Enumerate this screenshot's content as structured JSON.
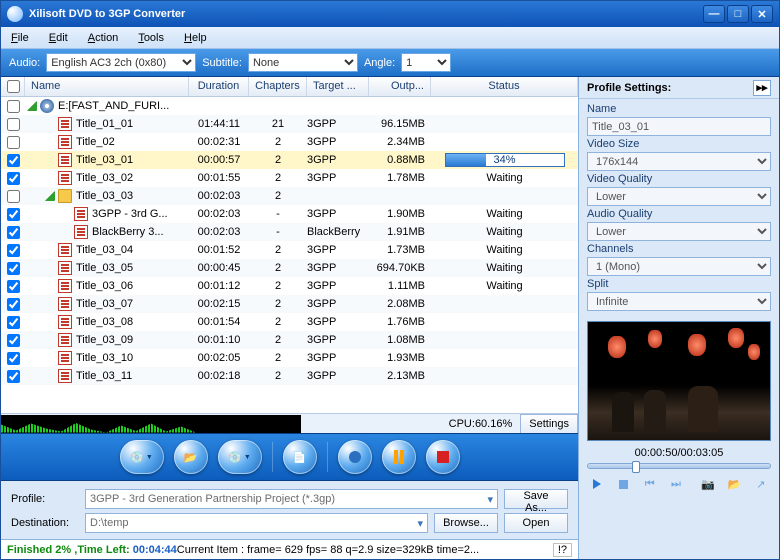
{
  "window": {
    "title": "Xilisoft DVD to 3GP Converter"
  },
  "menu": {
    "file": "File",
    "edit": "Edit",
    "action": "Action",
    "tools": "Tools",
    "help": "Help"
  },
  "params": {
    "audio_label": "Audio:",
    "audio_value": "English AC3 2ch (0x80)",
    "subtitle_label": "Subtitle:",
    "subtitle_value": "None",
    "angle_label": "Angle:",
    "angle_value": "1"
  },
  "columns": {
    "name": "Name",
    "duration": "Duration",
    "chapters": "Chapters",
    "target": "Target ...",
    "outp": "Outp...",
    "status": "Status"
  },
  "rows": [
    {
      "level": 0,
      "chk": false,
      "icon": "disc",
      "tw": true,
      "name": "E:[FAST_AND_FURI...",
      "dur": "",
      "chap": "",
      "target": "",
      "outp": "",
      "status": ""
    },
    {
      "level": 1,
      "chk": false,
      "icon": "doc",
      "name": "Title_01_01",
      "dur": "01:44:11",
      "chap": "21",
      "target": "3GPP",
      "outp": "96.15MB",
      "status": ""
    },
    {
      "level": 1,
      "chk": false,
      "icon": "doc",
      "name": "Title_02",
      "dur": "00:02:31",
      "chap": "2",
      "target": "3GPP",
      "outp": "2.34MB",
      "status": ""
    },
    {
      "level": 1,
      "chk": true,
      "icon": "doc",
      "sel": true,
      "name": "Title_03_01",
      "dur": "00:00:57",
      "chap": "2",
      "target": "3GPP",
      "outp": "0.88MB",
      "status_progress": 34
    },
    {
      "level": 1,
      "chk": true,
      "icon": "doc",
      "name": "Title_03_02",
      "dur": "00:01:55",
      "chap": "2",
      "target": "3GPP",
      "outp": "1.78MB",
      "status": "Waiting"
    },
    {
      "level": 1,
      "chk": false,
      "icon": "folder",
      "tw": true,
      "name": "Title_03_03",
      "dur": "00:02:03",
      "chap": "2",
      "target": "",
      "outp": "",
      "status": ""
    },
    {
      "level": 2,
      "chk": true,
      "icon": "doc",
      "name": "3GPP - 3rd G...",
      "dur": "00:02:03",
      "chap": "-",
      "target": "3GPP",
      "outp": "1.90MB",
      "status": "Waiting"
    },
    {
      "level": 2,
      "chk": true,
      "icon": "doc",
      "name": "BlackBerry 3...",
      "dur": "00:02:03",
      "chap": "-",
      "target": "BlackBerry",
      "outp": "1.91MB",
      "status": "Waiting"
    },
    {
      "level": 1,
      "chk": true,
      "icon": "doc",
      "name": "Title_03_04",
      "dur": "00:01:52",
      "chap": "2",
      "target": "3GPP",
      "outp": "1.73MB",
      "status": "Waiting"
    },
    {
      "level": 1,
      "chk": true,
      "icon": "doc",
      "name": "Title_03_05",
      "dur": "00:00:45",
      "chap": "2",
      "target": "3GPP",
      "outp": "694.70KB",
      "status": "Waiting"
    },
    {
      "level": 1,
      "chk": true,
      "icon": "doc",
      "name": "Title_03_06",
      "dur": "00:01:12",
      "chap": "2",
      "target": "3GPP",
      "outp": "1.11MB",
      "status": "Waiting"
    },
    {
      "level": 1,
      "chk": true,
      "icon": "doc",
      "name": "Title_03_07",
      "dur": "00:02:15",
      "chap": "2",
      "target": "3GPP",
      "outp": "2.08MB",
      "status": ""
    },
    {
      "level": 1,
      "chk": true,
      "icon": "doc",
      "name": "Title_03_08",
      "dur": "00:01:54",
      "chap": "2",
      "target": "3GPP",
      "outp": "1.76MB",
      "status": ""
    },
    {
      "level": 1,
      "chk": true,
      "icon": "doc",
      "name": "Title_03_09",
      "dur": "00:01:10",
      "chap": "2",
      "target": "3GPP",
      "outp": "1.08MB",
      "status": ""
    },
    {
      "level": 1,
      "chk": true,
      "icon": "doc",
      "name": "Title_03_10",
      "dur": "00:02:05",
      "chap": "2",
      "target": "3GPP",
      "outp": "1.93MB",
      "status": ""
    },
    {
      "level": 1,
      "chk": true,
      "icon": "doc",
      "name": "Title_03_11",
      "dur": "00:02:18",
      "chap": "2",
      "target": "3GPP",
      "outp": "2.13MB",
      "status": ""
    }
  ],
  "cpu": {
    "label": "CPU:",
    "value": "60.16%",
    "settings": "Settings"
  },
  "profile": {
    "profile_label": "Profile:",
    "profile_value": "3GPP - 3rd Generation Partnership Project  (*.3gp)",
    "saveas": "Save As...",
    "dest_label": "Destination:",
    "dest_value": "D:\\temp",
    "browse": "Browse...",
    "open": "Open"
  },
  "status": {
    "finished": "Finished",
    "percent": "2%",
    "timeleft_label": ",Time Left:",
    "timeleft": "00:04:44",
    "rest": " Current Item : frame=  629 fps=  88 q=2.9 size=329kB time=2...",
    "bang": "!?"
  },
  "right": {
    "heading": "Profile Settings:",
    "name_label": "Name",
    "name_value": "Title_03_01",
    "videosize_label": "Video Size",
    "videosize_value": "176x144",
    "videoqual_label": "Video Quality",
    "videoqual_value": "Lower",
    "audioqual_label": "Audio Quality",
    "audioqual_value": "Lower",
    "channels_label": "Channels",
    "channels_value": "1 (Mono)",
    "split_label": "Split",
    "split_value": "Infinite",
    "time": "00:00:50/00:03:05"
  }
}
